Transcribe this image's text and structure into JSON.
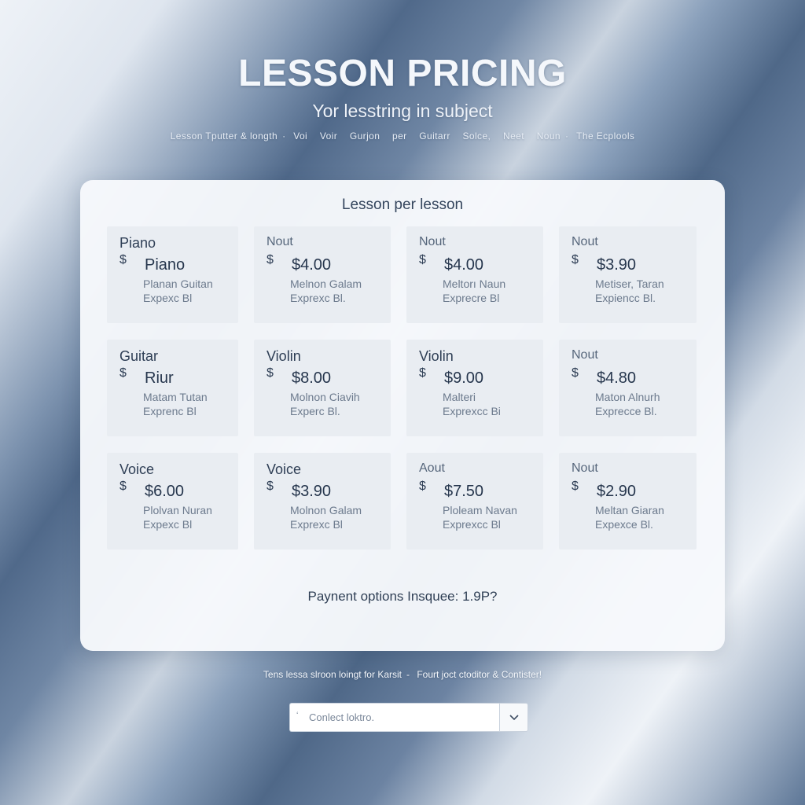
{
  "header": {
    "title": "LESSON PRICING",
    "subtitle": "Yor lesstring in subject",
    "breadcrumb": [
      "Lesson Tputter & longth",
      "Voi",
      "Voir",
      "Gurjon",
      "per",
      "Guitarr",
      "Solce,",
      "Neet",
      "Noun",
      "The Ecplools"
    ]
  },
  "card": {
    "heading": "Lesson per lesson",
    "tiles": [
      {
        "name": "Piano",
        "currency": "$",
        "price": "Piano",
        "desc1": "Planan Guitan",
        "desc2": "Expexc Bl"
      },
      {
        "name": "Nout",
        "currency": "$",
        "price": "$4.00",
        "desc1": "Melnon Galam",
        "desc2": "Exprexc Bl."
      },
      {
        "name": "Nout",
        "currency": "$",
        "price": "$4.00",
        "desc1": "Meltorı Naun",
        "desc2": "Exprecre Bl"
      },
      {
        "name": "Nout",
        "currency": "$",
        "price": "$3.90",
        "desc1": "Metiser, Taran",
        "desc2": "Expiencc Bl."
      },
      {
        "name": "Guitar",
        "currency": "$",
        "price": "Riur",
        "desc1": "Matam Tutan",
        "desc2": "Exprenc Bl"
      },
      {
        "name": "Violin",
        "currency": "$",
        "price": "$8.00",
        "desc1": "Molnon Ciavih",
        "desc2": "Experc Bl."
      },
      {
        "name": "Violin",
        "currency": "$",
        "price": "$9.00",
        "desc1": "Malteri",
        "desc2": "Exprexcc Bi"
      },
      {
        "name": "Nout",
        "currency": "$",
        "price": "$4.80",
        "desc1": "Maton Alnurh",
        "desc2": "Exprecce Bl."
      },
      {
        "name": "Voice",
        "currency": "$",
        "price": "$6.00",
        "desc1": "Plolvan Nuran",
        "desc2": "Expexc Bl"
      },
      {
        "name": "Voice",
        "currency": "$",
        "price": "$3.90",
        "desc1": "Molnon Galam",
        "desc2": "Exprexc Bl"
      },
      {
        "name": "Aout",
        "currency": "$",
        "price": "$7.50",
        "desc1": "Ploleam Navan",
        "desc2": "Exprexcc Bl"
      },
      {
        "name": "Nout",
        "currency": "$",
        "price": "$2.90",
        "desc1": "Meltan Giaran",
        "desc2": "Expexce Bl."
      }
    ],
    "payment_text": "Paynent options Insquee: 1.9P?"
  },
  "footer": {
    "note": [
      "Tens lessa slroon loingt for Karsit",
      "Fourt joct ctoditor & Contister!"
    ],
    "contact_lead": "‘",
    "contact_placeholder": "Conlect loktro.",
    "dropdown_icon": "chevron-down-icon"
  },
  "colors": {
    "card_bg": "#f7f9fb",
    "tile_bg": "#e9edf2",
    "text_dark": "#2f3f55",
    "text_muted": "#6c7a8d",
    "background_blue": "#50698a"
  }
}
